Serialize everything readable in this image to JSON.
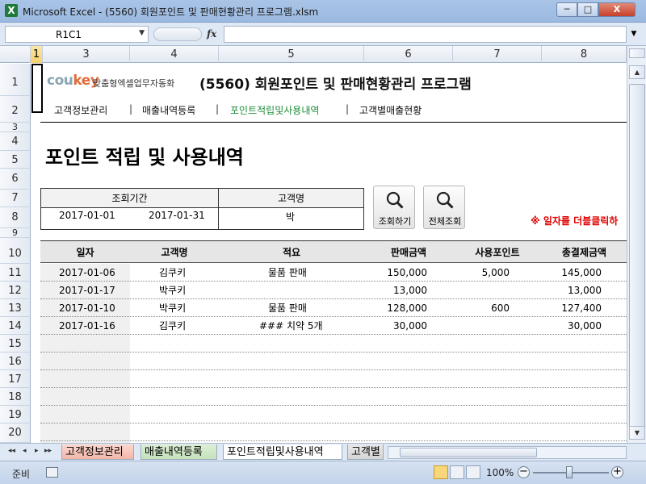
{
  "window": {
    "title": "Microsoft Excel - (5560) 회원포인트 및 판매현황관리 프로그램.xlsm",
    "app_icon": "X",
    "min_label": "─",
    "max_label": "□",
    "close_label": "X"
  },
  "formula_bar": {
    "name_box": "R1C1",
    "fx": "fx",
    "formula": ""
  },
  "columns": [
    "1",
    "3",
    "4",
    "5",
    "6",
    "7",
    "8"
  ],
  "rows": [
    "1",
    "2",
    "3",
    "4",
    "5",
    "6",
    "7",
    "8",
    "9",
    "10",
    "11",
    "12",
    "13",
    "14",
    "15",
    "16",
    "17",
    "18",
    "19",
    "20"
  ],
  "header": {
    "logo_main": "cou",
    "logo_accent": "key",
    "logo_sub": "맞춤형엑셀업무자동화",
    "title": "(5560) 회원포인트 및 판매현황관리 프로그램"
  },
  "nav": [
    {
      "label": "고객정보관리"
    },
    {
      "label": "매출내역등록"
    },
    {
      "label": "포인트적립및사용내역"
    },
    {
      "label": "고객별매출현황"
    }
  ],
  "nav_sep": "|",
  "section_title": "포인트 적립 및 사용내역",
  "search": {
    "period_label": "조회기간",
    "customer_label": "고객명",
    "start_date": "2017-01-01",
    "end_date": "2017-01-31",
    "customer_value": "박",
    "search_button": "조회하기",
    "all_button": "전체조회"
  },
  "note": "※ 일자를 더블클릭하",
  "table": {
    "headers": [
      "일자",
      "고객명",
      "적요",
      "판매금액",
      "사용포인트",
      "총결제금액"
    ],
    "rows": [
      [
        "2017-01-06",
        "김쿠키",
        "물품 판매",
        "150,000",
        "5,000",
        "145,000"
      ],
      [
        "2017-01-17",
        "박쿠키",
        "",
        "13,000",
        "",
        "13,000"
      ],
      [
        "2017-01-10",
        "박쿠키",
        "물품 판매",
        "128,000",
        "600",
        "127,400"
      ],
      [
        "2017-01-16",
        "김쿠키",
        "### 치약 5개",
        "30,000",
        "",
        "30,000"
      ]
    ]
  },
  "sheet_tabs": [
    "고객정보관리",
    "매출내역등록",
    "포인트적립및사용내역",
    "고객별"
  ],
  "tab_nav": [
    "◂◂",
    "◂",
    "▸",
    "▸▸"
  ],
  "status": {
    "mode": "준비",
    "zoom": "100%",
    "zoom_minus": "−",
    "zoom_plus": "+"
  },
  "accent_colors": {
    "nav_active": "#1e8d3a",
    "note": "#e00000",
    "logo_accent": "#e06d3b"
  }
}
